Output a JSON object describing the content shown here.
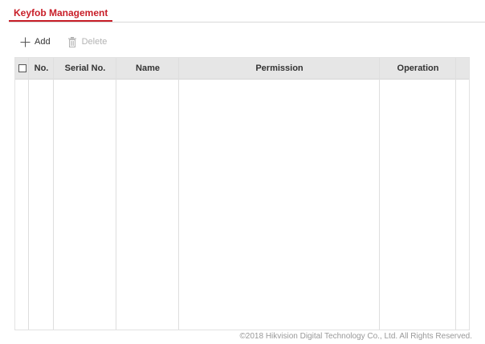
{
  "tabs": {
    "active_label": "Keyfob Management"
  },
  "toolbar": {
    "add_label": "Add",
    "add_icon": "plus-icon",
    "delete_label": "Delete",
    "delete_icon": "trash-icon",
    "delete_enabled": false
  },
  "table": {
    "columns": [
      "No.",
      "Serial No.",
      "Name",
      "Permission",
      "Operation"
    ],
    "select_all_checked": false,
    "rows": []
  },
  "footer": {
    "copyright": "©2018 Hikvision Digital Technology Co., Ltd. All Rights Reserved."
  },
  "colors": {
    "accent": "#c81e28",
    "header_bg": "#e6e6e6",
    "disabled_text": "#b3b3b3"
  }
}
